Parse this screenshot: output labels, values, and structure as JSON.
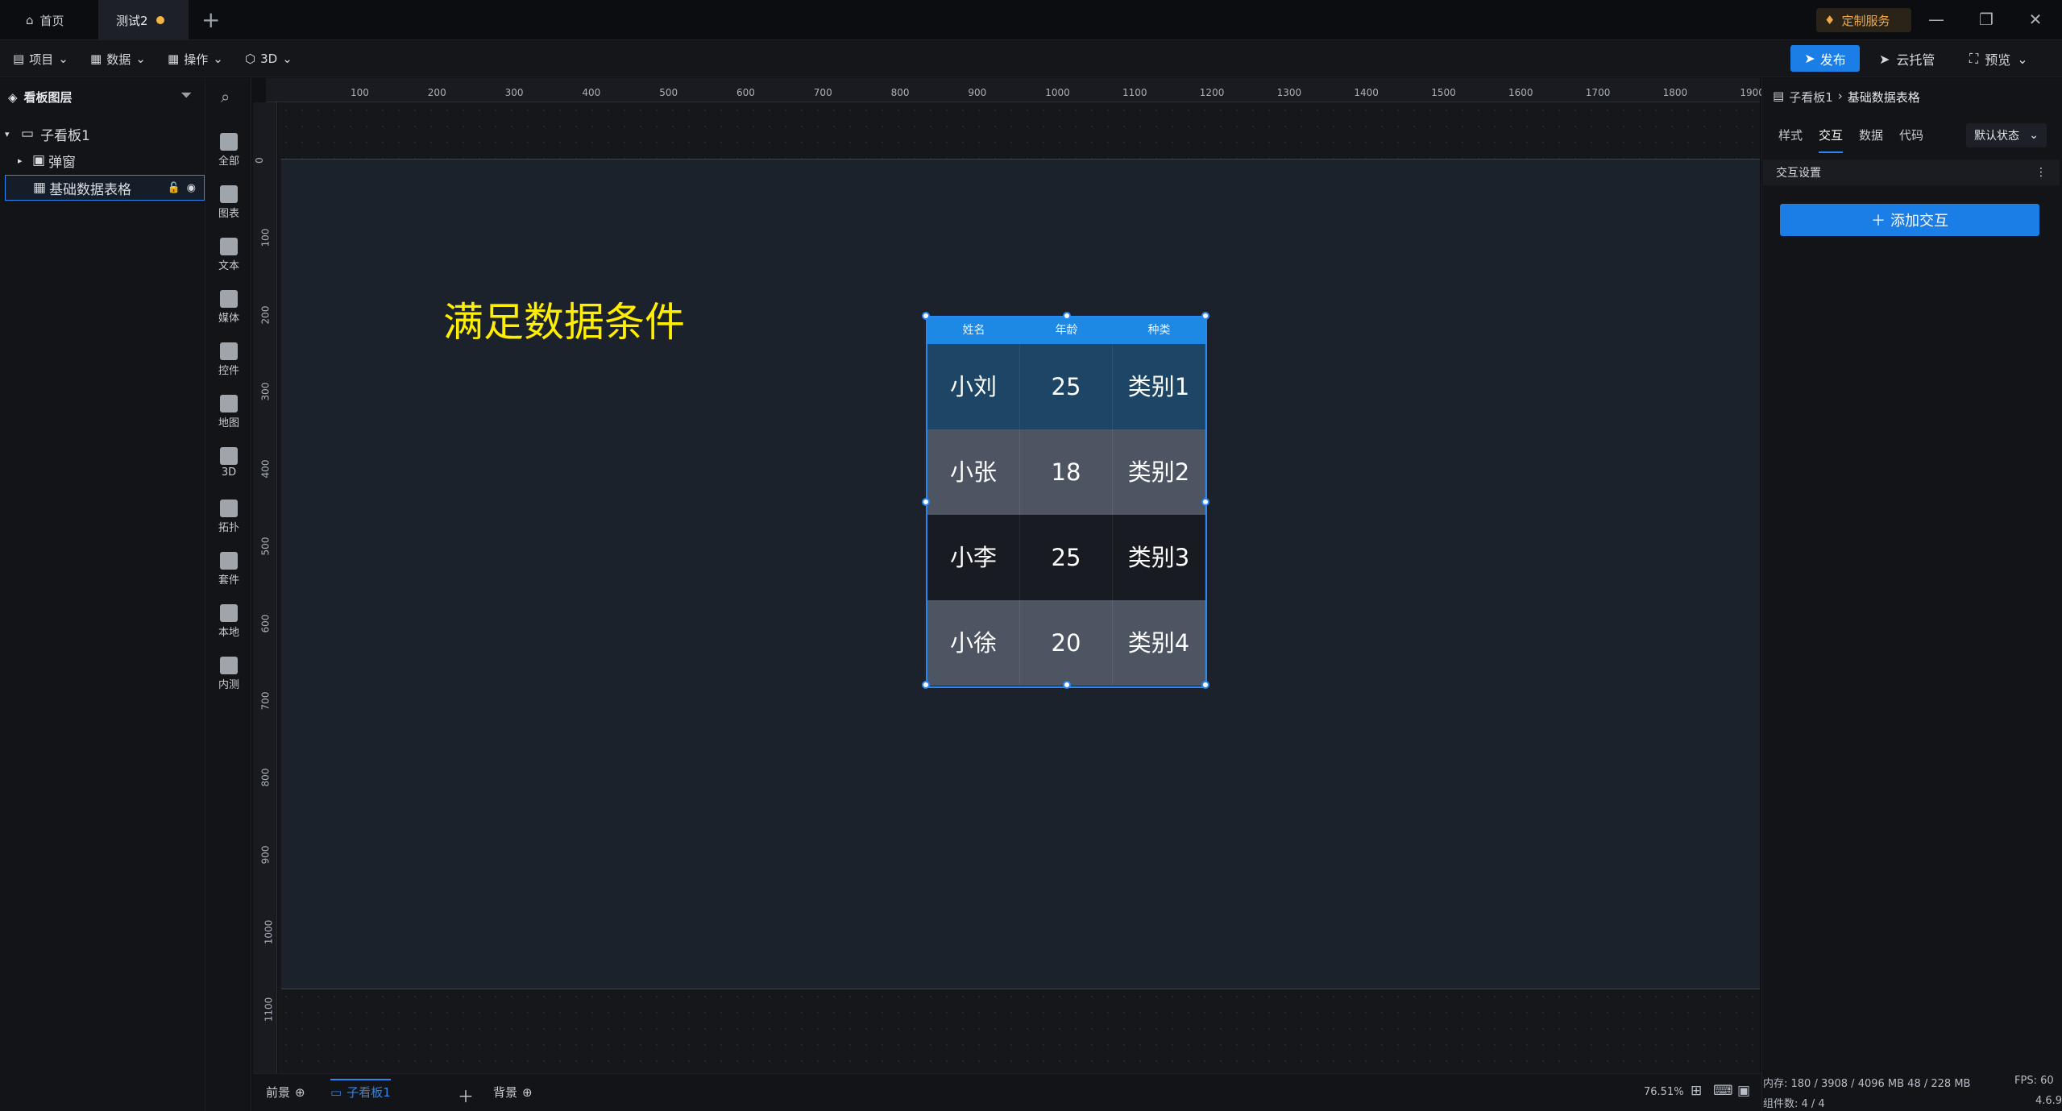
{
  "titlebar": {
    "tabs": [
      {
        "label": "首页",
        "icon": "home-icon"
      },
      {
        "label": "测试2",
        "icon": "unsaved-dot"
      }
    ],
    "new_tab": "+",
    "custom_service": "定制服务",
    "window_controls": [
      "—",
      "❐",
      "✕"
    ]
  },
  "toolbar": {
    "menus": [
      {
        "label": "项目",
        "icon": "file-icon"
      },
      {
        "label": "数据",
        "icon": "database-icon"
      },
      {
        "label": "操作",
        "icon": "grid-icon"
      },
      {
        "label": "3D",
        "icon": "cube-icon"
      }
    ],
    "publish": "发布",
    "cloud_host": "云托管",
    "preview": "预览"
  },
  "layer_panel": {
    "title": "看板图层",
    "items": [
      {
        "label": "子看板1"
      },
      {
        "label": "弹窗"
      },
      {
        "label": "基础数据表格"
      }
    ]
  },
  "rail": {
    "items": [
      "全部",
      "图表",
      "文本",
      "媒体",
      "控件",
      "地图",
      "3D",
      "拓扑",
      "套件",
      "本地",
      "内测"
    ]
  },
  "ruler": {
    "top_ticks": [
      "100",
      "200",
      "300",
      "400",
      "500",
      "600",
      "700",
      "800",
      "900",
      "1000",
      "1100",
      "1200",
      "1300",
      "1400",
      "1500",
      "1600",
      "1700",
      "1800",
      "1900"
    ],
    "left_ticks": [
      "0",
      "100",
      "200",
      "300",
      "400",
      "500",
      "600",
      "700",
      "800",
      "900",
      "1000",
      "1100"
    ]
  },
  "canvas": {
    "text_widget": "满足数据条件",
    "table": {
      "headers": [
        "姓名",
        "年龄",
        "种类"
      ],
      "rows": [
        [
          "小刘",
          "25",
          "类别1"
        ],
        [
          "小张",
          "18",
          "类别2"
        ],
        [
          "小李",
          "25",
          "类别3"
        ],
        [
          "小徐",
          "20",
          "类别4"
        ]
      ],
      "row_colors": [
        "#1c4566",
        "#4d5563",
        "#181b21",
        "#4d5563"
      ]
    }
  },
  "properties": {
    "breadcrumb": [
      "子看板1",
      "基础数据表格"
    ],
    "tabs": [
      "样式",
      "交互",
      "数据",
      "代码"
    ],
    "active_tab": "交互",
    "state": "默认状态",
    "section": "交互设置",
    "add_button": "添加交互"
  },
  "bottombar": {
    "foreground": "前景",
    "board": "子看板1",
    "background": "背景",
    "zoom": "76.51%",
    "memory": "内存: 180 / 3908 / 4096 MB  48 / 228 MB",
    "components": "组件数: 4 / 4",
    "fps": "FPS:  60",
    "version": "4.6.9"
  },
  "colors": {
    "accent": "#1b7de6",
    "condition_text": "#ffee00"
  }
}
